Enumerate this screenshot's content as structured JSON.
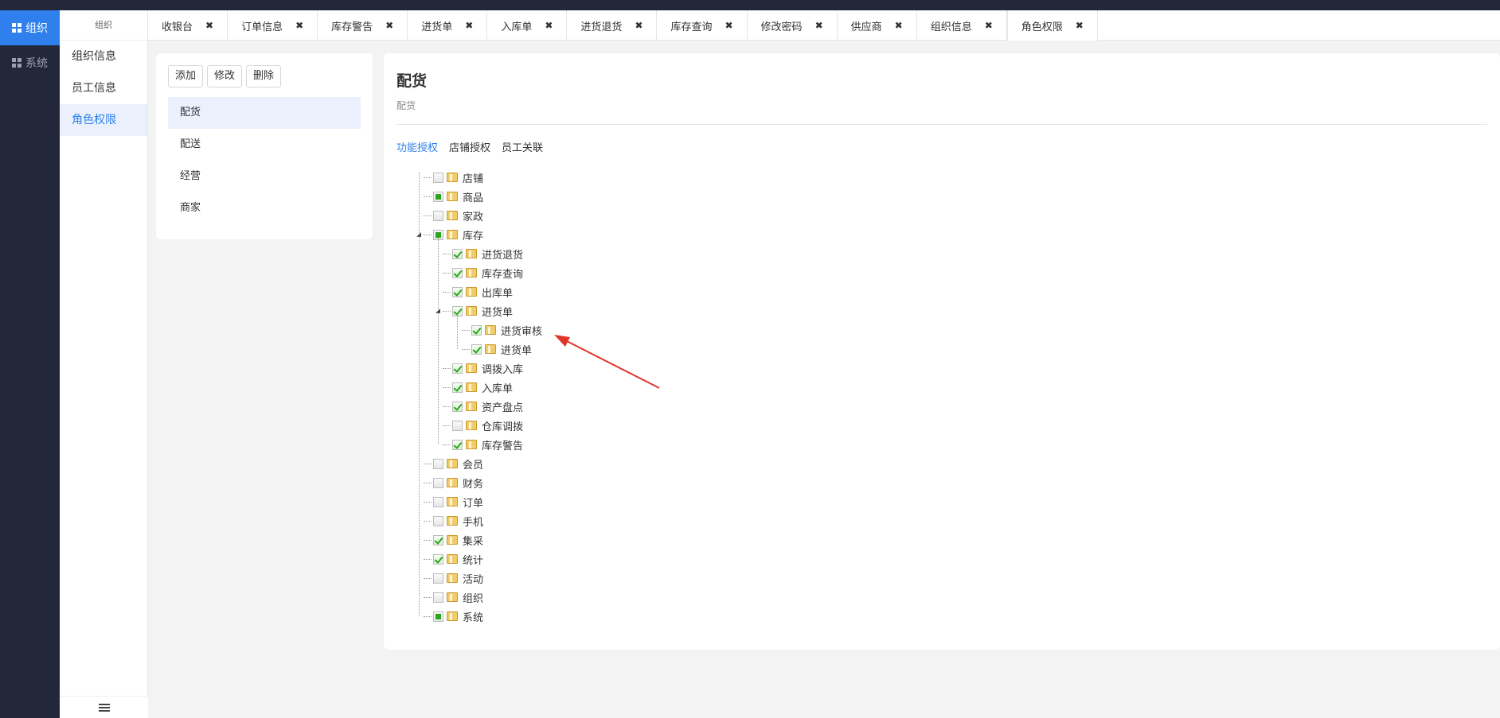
{
  "leftnav": {
    "items": [
      {
        "label": "组织",
        "active": true
      },
      {
        "label": "系统",
        "active": false
      }
    ]
  },
  "subnav": {
    "header": "组织",
    "items": [
      {
        "label": "组织信息",
        "active": false
      },
      {
        "label": "员工信息",
        "active": false
      },
      {
        "label": "角色权限",
        "active": true
      }
    ]
  },
  "tabs": [
    {
      "label": "收银台",
      "close": "✖"
    },
    {
      "label": "订单信息",
      "close": "✖"
    },
    {
      "label": "库存警告",
      "close": "✖"
    },
    {
      "label": "进货单",
      "close": "✖"
    },
    {
      "label": "入库单",
      "close": "✖"
    },
    {
      "label": "进货退货",
      "close": "✖"
    },
    {
      "label": "库存查询",
      "close": "✖"
    },
    {
      "label": "修改密码",
      "close": "✖"
    },
    {
      "label": "供应商",
      "close": "✖"
    },
    {
      "label": "组织信息",
      "close": "✖"
    },
    {
      "label": "角色权限",
      "close": "✖",
      "active": true
    }
  ],
  "roles": {
    "buttons": {
      "add": "添加",
      "edit": "修改",
      "delete": "删除"
    },
    "items": [
      {
        "label": "配货",
        "active": true
      },
      {
        "label": "配送",
        "active": false
      },
      {
        "label": "经营",
        "active": false
      },
      {
        "label": "商家",
        "active": false
      }
    ]
  },
  "detail": {
    "title": "配货",
    "subtitle": "配货",
    "subtabs": [
      {
        "label": "功能授权",
        "active": true
      },
      {
        "label": "店铺授权",
        "active": false
      },
      {
        "label": "员工关联",
        "active": false
      }
    ]
  },
  "tree": [
    {
      "label": "店铺",
      "level": 0,
      "state": "unchecked"
    },
    {
      "label": "商品",
      "level": 0,
      "state": "partial"
    },
    {
      "label": "家政",
      "level": 0,
      "state": "unchecked"
    },
    {
      "label": "库存",
      "level": 0,
      "state": "partial",
      "expanded": true
    },
    {
      "label": "进货退货",
      "level": 1,
      "state": "checked"
    },
    {
      "label": "库存查询",
      "level": 1,
      "state": "checked"
    },
    {
      "label": "出库单",
      "level": 1,
      "state": "checked"
    },
    {
      "label": "进货单",
      "level": 1,
      "state": "checked",
      "expanded": true
    },
    {
      "label": "进货审核",
      "level": 2,
      "state": "checked"
    },
    {
      "label": "进货单",
      "level": 2,
      "state": "checked"
    },
    {
      "label": "调拨入库",
      "level": 1,
      "state": "checked"
    },
    {
      "label": "入库单",
      "level": 1,
      "state": "checked"
    },
    {
      "label": "资产盘点",
      "level": 1,
      "state": "checked"
    },
    {
      "label": "仓库调拨",
      "level": 1,
      "state": "unchecked"
    },
    {
      "label": "库存警告",
      "level": 1,
      "state": "checked"
    },
    {
      "label": "会员",
      "level": 0,
      "state": "unchecked"
    },
    {
      "label": "财务",
      "level": 0,
      "state": "unchecked"
    },
    {
      "label": "订单",
      "level": 0,
      "state": "unchecked"
    },
    {
      "label": "手机",
      "level": 0,
      "state": "unchecked"
    },
    {
      "label": "集采",
      "level": 0,
      "state": "checked"
    },
    {
      "label": "统计",
      "level": 0,
      "state": "checked"
    },
    {
      "label": "活动",
      "level": 0,
      "state": "unchecked"
    },
    {
      "label": "组织",
      "level": 0,
      "state": "unchecked"
    },
    {
      "label": "系统",
      "level": 0,
      "state": "partial"
    }
  ],
  "annotation": {
    "color": "#e0352b"
  }
}
